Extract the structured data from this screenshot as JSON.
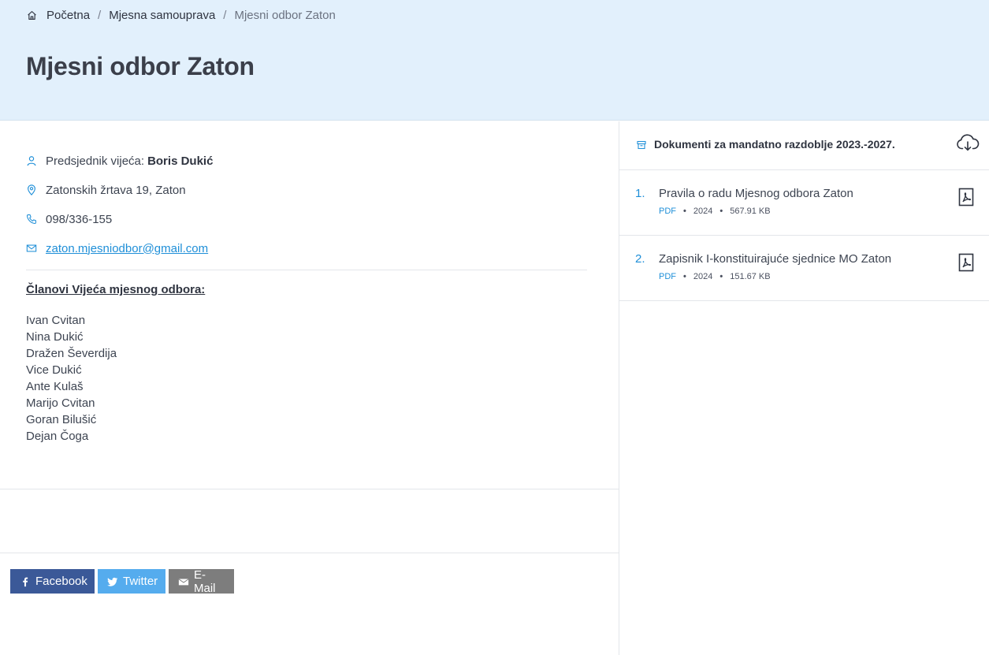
{
  "breadcrumb": {
    "items": [
      "Početna",
      "Mjesna samouprava"
    ],
    "separator": "/",
    "current": "Mjesni odbor Zaton"
  },
  "page": {
    "title": "Mjesni odbor Zaton"
  },
  "info": {
    "president_label": "Predsjednik vijeća:",
    "president_name": "Boris Dukić",
    "address": "Zatonskih žrtava 19, Zaton",
    "phone": "098/336-155",
    "email": "zaton.mjesniodbor@gmail.com"
  },
  "members": {
    "heading": "Članovi Vijeća mjesnog odbora:",
    "list": [
      "Ivan Cvitan",
      "Nina Dukić",
      "Dražen Ševerdija",
      "Vice Dukić",
      "Ante Kulaš",
      "Marijo Cvitan",
      "Goran Bilušić",
      "Dejan Čoga"
    ]
  },
  "share": {
    "facebook": "Facebook",
    "twitter": "Twitter",
    "email": "E-Mail"
  },
  "documents": {
    "title": "Dokumenti za mandatno razdoblje 2023.-2027.",
    "items": [
      {
        "num": "1.",
        "name": "Pravila o radu Mjesnog odbora Zaton",
        "type": "PDF",
        "year": "2024",
        "size": "567.91 KB"
      },
      {
        "num": "2.",
        "name": "Zapisnik I-konstituirajuće sjednice MO Zaton",
        "type": "PDF",
        "year": "2024",
        "size": "151.67 KB"
      }
    ]
  },
  "colors": {
    "hero_bg": "#e2f0fc",
    "accent": "#1f8fd8",
    "facebook": "#3b5998",
    "twitter": "#55acee",
    "email": "#7d7d7d"
  }
}
